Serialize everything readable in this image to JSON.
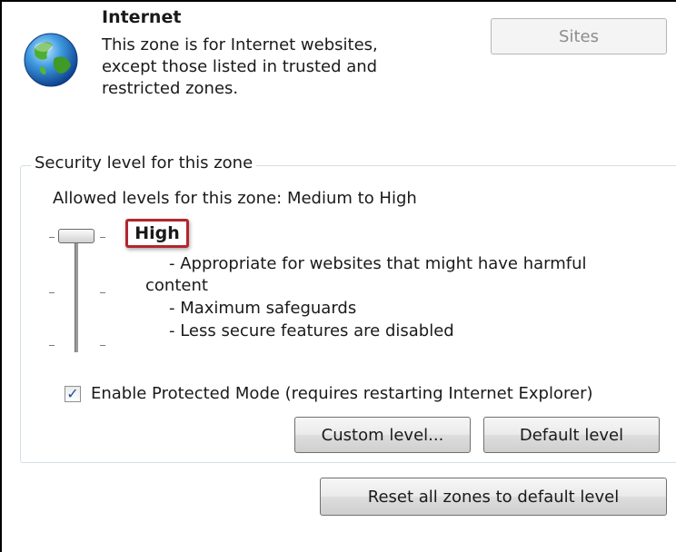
{
  "zone": {
    "title": "Internet",
    "description_lines": [
      "This zone is for Internet websites,",
      "except those listed in trusted and",
      "restricted zones."
    ],
    "icon": "globe-icon"
  },
  "buttons": {
    "sites": "Sites",
    "custom_level": "Custom level...",
    "default_level": "Default level",
    "reset_all": "Reset all zones to default level"
  },
  "security": {
    "group_label": "Security level for this zone",
    "allowed_levels": "Allowed levels for this zone: Medium to High",
    "level_name": "High",
    "level_description": [
      "- Appropriate for websites that might have harmful",
      "content",
      "- Maximum safeguards",
      "- Less secure features are disabled"
    ],
    "slider_position": "top"
  },
  "protected_mode": {
    "label": "Enable Protected Mode (requires restarting Internet Explorer)",
    "checked": true
  },
  "colors": {
    "highlight_border": "#b3262e",
    "checkmark": "#1b4f9c"
  }
}
